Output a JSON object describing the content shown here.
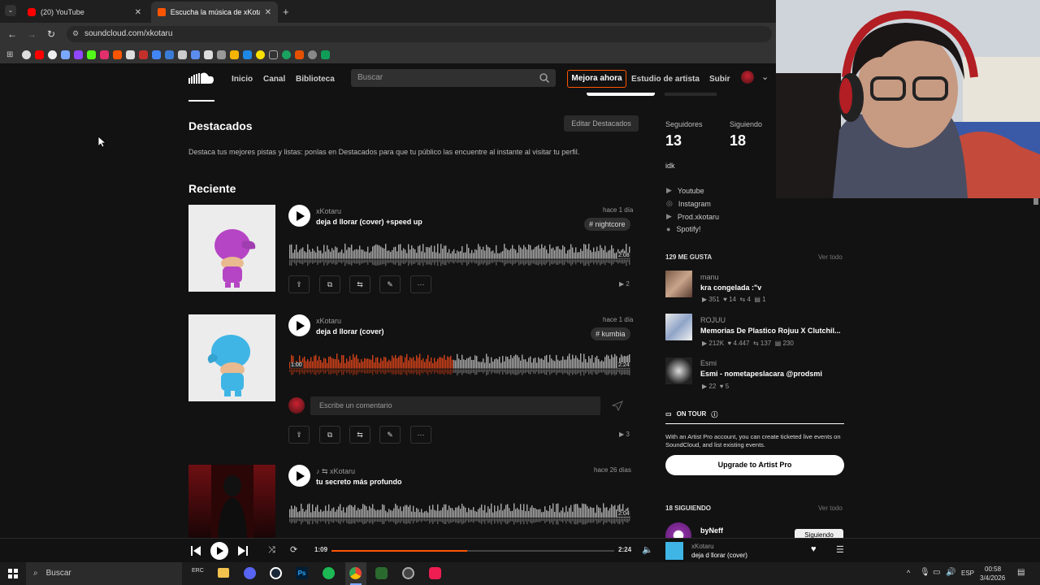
{
  "browser": {
    "tabs": [
      {
        "title": "(20) YouTube"
      },
      {
        "title": "Escucha la música de xKotaru |"
      }
    ],
    "url": "soundcloud.com/xkotaru"
  },
  "header": {
    "nav": [
      "Inicio",
      "Canal",
      "Biblioteca"
    ],
    "search_placeholder": "Buscar",
    "upgrade": "Mejora ahora",
    "artist_studio": "Estudio de artista",
    "upload": "Subir"
  },
  "featured": {
    "title": "Destacados",
    "edit": "Editar Destacados",
    "description": "Destaca tus mejores pistas y listas: ponlas en Destacados para que tu público las encuentre al instante al visitar tu perfil."
  },
  "recent": {
    "title": "Reciente",
    "tracks": [
      {
        "artist": "xKotaru",
        "title": "deja d llorar (cover) +speed up",
        "date": "hace 1 día",
        "tag": "# nightcore",
        "duration": "2:08",
        "plays": "2",
        "progress": 0
      },
      {
        "artist": "xKotaru",
        "title": "deja d llorar (cover)",
        "date": "hace 1 día",
        "tag": "# kumbia",
        "duration": "2:24",
        "elapsed": "1:00",
        "plays": "3",
        "progress": 0.48,
        "comment_placeholder": "Escribe un comentario"
      },
      {
        "artist": "xKotaru",
        "title": "tu secreto más profundo",
        "date": "hace 26 días",
        "duration": "2:04",
        "progress": 0
      }
    ]
  },
  "sidebar": {
    "followers_label": "Seguidores",
    "followers": "13",
    "following_label": "Siguiendo",
    "following": "18",
    "bio": "idk",
    "links": [
      "Youtube",
      "Instagram",
      "Prod.xkotaru",
      "Spotify!"
    ],
    "likes_header": "129 ME GUSTA",
    "view_all": "Ver todo",
    "likes": [
      {
        "user": "manu",
        "title": "kra congelada :\"v",
        "stats": [
          "351",
          "14",
          "4",
          "1"
        ]
      },
      {
        "user": "ROJUU",
        "title": "Memorias De Plastico Rojuu X Clutchil...",
        "stats": [
          "212K",
          "4.447",
          "137",
          "230"
        ]
      },
      {
        "user": "Esmi",
        "title": "Esmi - nometapeslacara @prodsmi",
        "stats": [
          "22",
          "5"
        ]
      }
    ],
    "on_tour": "ON TOUR",
    "artist_pro_text": "With an Artist Pro account, you can create ticketed live events on SoundCloud, and list existing events.",
    "artist_pro_button": "Upgrade to Artist Pro",
    "following_header": "18 SIGUIENDO",
    "following_first": "byNeff",
    "following_btn": "Siguiendo"
  },
  "player": {
    "elapsed": "1:09",
    "total": "2:24",
    "progress": 0.48,
    "artist": "xKotaru",
    "title": "deja d llorar (cover)"
  },
  "taskbar": {
    "search": "Buscar",
    "lang": "ESP",
    "time": "00:58",
    "date": "3/4/2026"
  },
  "colors": {
    "accent": "#ff5500",
    "bg": "#121212"
  }
}
